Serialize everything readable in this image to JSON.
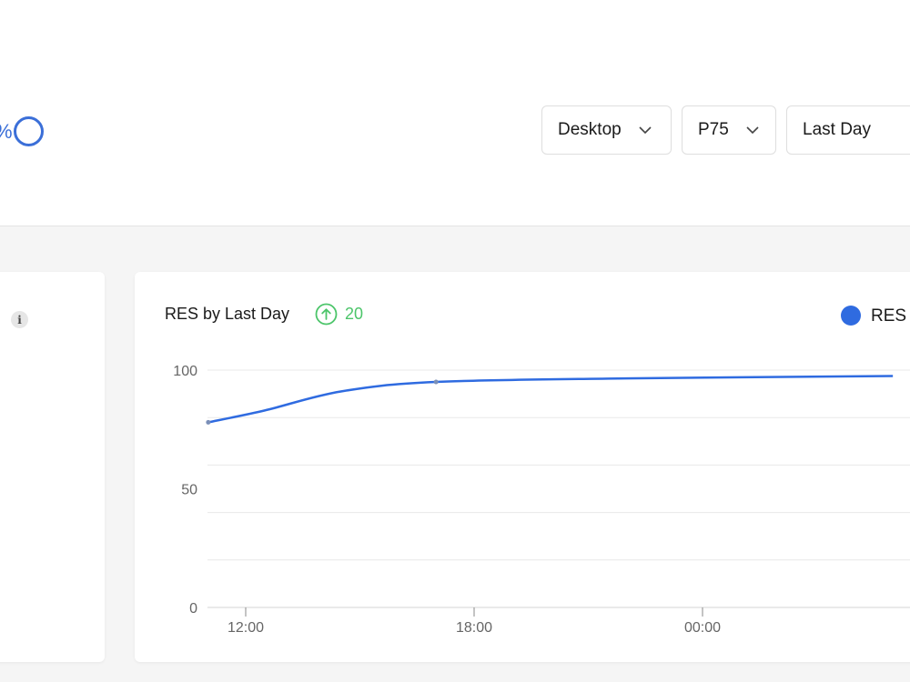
{
  "header": {
    "partial_text": "%",
    "filters": [
      {
        "label": "Desktop"
      },
      {
        "label": "P75"
      },
      {
        "label": "Last Day"
      }
    ]
  },
  "chart_card": {
    "title": "RES by Last Day",
    "trend": {
      "direction": "up",
      "value": "20",
      "color": "#4cc56a"
    },
    "legend": {
      "label": "RES",
      "color": "#2f6be0"
    }
  },
  "chart_data": {
    "type": "line",
    "ylim": [
      0,
      100
    ],
    "y_ticks": [
      "0",
      "50",
      "100"
    ],
    "x_ticks": [
      "12:00",
      "18:00",
      "00:00"
    ],
    "series": [
      {
        "name": "RES",
        "color": "#2f6be0",
        "points": [
          {
            "x": "11:01",
            "y": 78
          },
          {
            "x": "12:30",
            "y": 83
          },
          {
            "x": "14:30",
            "y": 91
          },
          {
            "x": "17:00",
            "y": 95
          },
          {
            "x": "22:00",
            "y": 96.5
          },
          {
            "x": "05:00",
            "y": 97.5
          }
        ],
        "markers": [
          {
            "x": "11:01",
            "y": 78
          },
          {
            "x": "17:00",
            "y": 95
          }
        ]
      }
    ],
    "gridlines": true
  }
}
